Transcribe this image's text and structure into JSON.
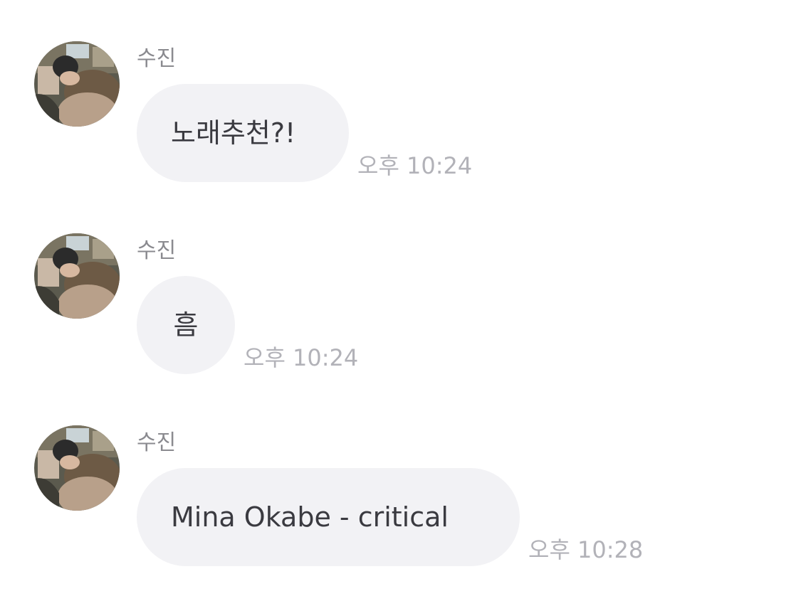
{
  "messages": [
    {
      "sender": "수진",
      "text": "노래추천?!",
      "time": "오후 10:24"
    },
    {
      "sender": "수진",
      "text": "흠",
      "time": "오후 10:24"
    },
    {
      "sender": "수진",
      "text": "Mina Okabe - critical",
      "time": "오후 10:28"
    }
  ],
  "colors": {
    "bubble": "#f2f2f5",
    "message_text": "#3a3a40",
    "sender_text": "#8a8a8f",
    "time_text": "#b2b2b8",
    "background": "#ffffff"
  }
}
